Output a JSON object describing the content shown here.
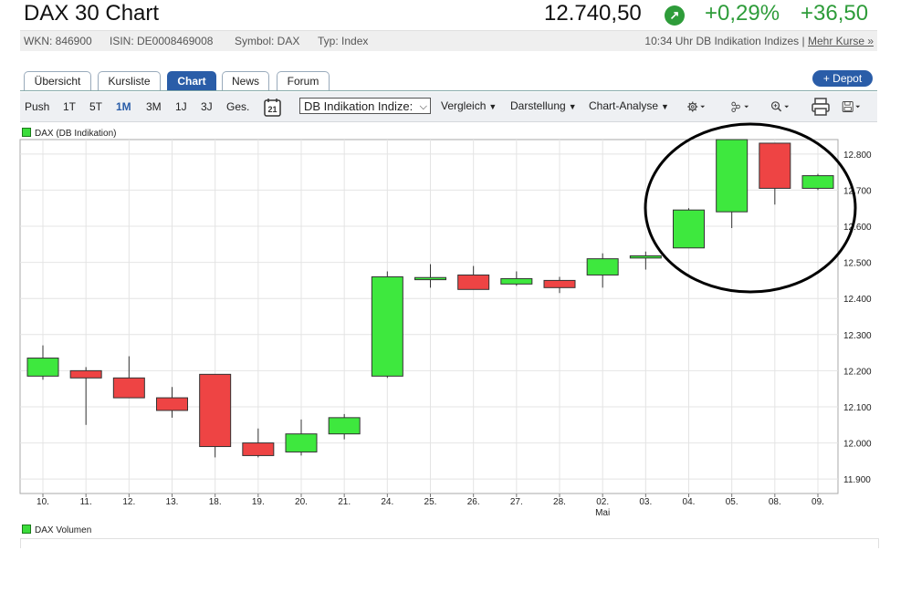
{
  "header": {
    "title": "DAX 30 Chart",
    "price": "12.740,50",
    "change_pct": "+0,29%",
    "change_abs": "+36,50",
    "up_color": "#2e9c3a"
  },
  "meta": {
    "wkn": "WKN: 846900",
    "isin": "ISIN: DE0008469008",
    "symbol": "Symbol: DAX",
    "type": "Typ: Index",
    "update": "10:34 Uhr DB Indikation Indizes |",
    "more_link": "Mehr Kurse »"
  },
  "tabs": [
    {
      "label": "Übersicht"
    },
    {
      "label": "Kursliste"
    },
    {
      "label": "Chart"
    },
    {
      "label": "News"
    },
    {
      "label": "Forum"
    }
  ],
  "depot_button": "+ Depot",
  "toolbar": {
    "ranges": [
      "Push",
      "1T",
      "5T",
      "1M",
      "3M",
      "1J",
      "3J",
      "Ges."
    ],
    "active_range": "1M",
    "calendar_day": "21",
    "source_select": "DB Indikation Indize:",
    "dropdowns": [
      "Vergleich",
      "Darstellung",
      "Chart-Analyse"
    ],
    "icons": [
      "gear-icon",
      "share-icon",
      "zoom-icon",
      "print-icon",
      "save-icon"
    ]
  },
  "legend_price": "DAX (DB Indikation)",
  "legend_volume": "DAX Volumen",
  "colors": {
    "up": "#3ee83e",
    "down": "#ee4444",
    "frame": "#aaaaaa"
  },
  "chart_data": {
    "type": "candlestick",
    "x_labels": [
      "10.",
      "11.",
      "12.",
      "13.",
      "18.",
      "19.",
      "20.",
      "21.",
      "24.",
      "25.",
      "26.",
      "27.",
      "28.",
      "02.",
      "03.",
      "04.",
      "05.",
      "08.",
      "09."
    ],
    "x_sublabel": {
      "index": 13,
      "text": "Mai"
    },
    "y_ticks": [
      "11.900",
      "12.000",
      "12.100",
      "12.200",
      "12.300",
      "12.400",
      "12.500",
      "12.600",
      "12.700",
      "12.800"
    ],
    "y_tick_values": [
      11900,
      12000,
      12100,
      12200,
      12300,
      12400,
      12500,
      12600,
      12700,
      12800
    ],
    "ylim": [
      11860,
      12840
    ],
    "candles": [
      {
        "o": 12185,
        "h": 12270,
        "l": 12175,
        "c": 12235
      },
      {
        "o": 12200,
        "h": 12210,
        "l": 12050,
        "c": 12180
      },
      {
        "o": 12180,
        "h": 12240,
        "l": 12125,
        "c": 12125
      },
      {
        "o": 12125,
        "h": 12155,
        "l": 12070,
        "c": 12090
      },
      {
        "o": 12190,
        "h": 12190,
        "l": 11960,
        "c": 11990
      },
      {
        "o": 12000,
        "h": 12040,
        "l": 11960,
        "c": 11965
      },
      {
        "o": 11975,
        "h": 12065,
        "l": 11965,
        "c": 12025
      },
      {
        "o": 12025,
        "h": 12080,
        "l": 12010,
        "c": 12070
      },
      {
        "o": 12185,
        "h": 12475,
        "l": 12180,
        "c": 12460
      },
      {
        "o": 12452,
        "h": 12495,
        "l": 12430,
        "c": 12458
      },
      {
        "o": 12465,
        "h": 12490,
        "l": 12425,
        "c": 12425
      },
      {
        "o": 12440,
        "h": 12475,
        "l": 12435,
        "c": 12455
      },
      {
        "o": 12450,
        "h": 12460,
        "l": 12415,
        "c": 12430
      },
      {
        "o": 12465,
        "h": 12525,
        "l": 12430,
        "c": 12510
      },
      {
        "o": 12512,
        "h": 12530,
        "l": 12480,
        "c": 12518
      },
      {
        "o": 12540,
        "h": 12650,
        "l": 12540,
        "c": 12645
      },
      {
        "o": 12640,
        "h": 12840,
        "l": 12595,
        "c": 12840
      },
      {
        "o": 12830,
        "h": 12830,
        "l": 12660,
        "c": 12705
      },
      {
        "o": 12705,
        "h": 12745,
        "l": 12700,
        "c": 12740
      }
    ],
    "annotation": "ellipse around last four candles"
  }
}
